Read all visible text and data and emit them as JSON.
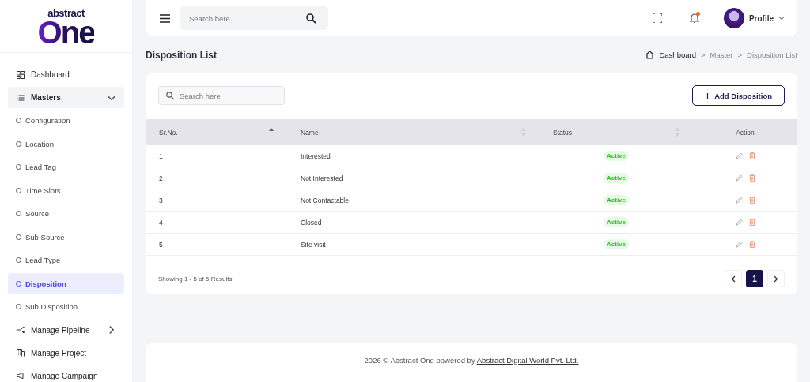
{
  "logo": {
    "top": "abstract",
    "main": "One"
  },
  "sidebar": {
    "items": [
      {
        "label": "Dashboard",
        "selected": false
      },
      {
        "label": "Masters",
        "selected": false,
        "expanded": true,
        "children": [
          {
            "label": "Configuration",
            "selected": false
          },
          {
            "label": "Location",
            "selected": false
          },
          {
            "label": "Lead Tag",
            "selected": false
          },
          {
            "label": "Time Slots",
            "selected": false
          },
          {
            "label": "Source",
            "selected": false
          },
          {
            "label": "Sub Source",
            "selected": false
          },
          {
            "label": "Lead Type",
            "selected": false
          },
          {
            "label": "Disposition",
            "selected": true
          },
          {
            "label": "Sub Disposition",
            "selected": false
          }
        ]
      },
      {
        "label": "Manage Pipeline",
        "selected": false,
        "expanded": false
      },
      {
        "label": "Manage Project",
        "selected": false
      },
      {
        "label": "Manage Campaign",
        "selected": false
      }
    ]
  },
  "header": {
    "search": {
      "placeholder": "Search here....."
    },
    "has_notification": true,
    "profile": "Profile"
  },
  "page": {
    "title": "Disposition List",
    "breadcrumb": [
      "Dashboard",
      "Master",
      "Disposition List"
    ],
    "separator": ">"
  },
  "toolbar": {
    "search": {
      "placeholder": "Search here"
    },
    "add_button": "Add Disposition"
  },
  "table": {
    "columns": [
      {
        "label": "Sr.No.",
        "sorted": true
      },
      {
        "label": "Name",
        "sorted": false
      },
      {
        "label": "Status",
        "sorted": false
      },
      {
        "label": "Action"
      }
    ],
    "rows": [
      {
        "sr": "1",
        "name": "Interested",
        "status": "Active",
        "active": true
      },
      {
        "sr": "2",
        "name": "Not Interested",
        "status": "Active",
        "active": true
      },
      {
        "sr": "3",
        "name": "Not Contactable",
        "status": "Active",
        "active": true
      },
      {
        "sr": "4",
        "name": "Closed",
        "status": "Active",
        "active": true
      },
      {
        "sr": "5",
        "name": "Site visit",
        "status": "Active",
        "active": true
      }
    ]
  },
  "summary": "Showing 1 - 5 of 5 Results",
  "pagination": {
    "pages": [
      {
        "label": "1",
        "selected": true
      }
    ]
  },
  "footer": {
    "text": "2026 © Abstract One powered by ",
    "link": "Abstract Digital World Pvt. Ltd."
  }
}
